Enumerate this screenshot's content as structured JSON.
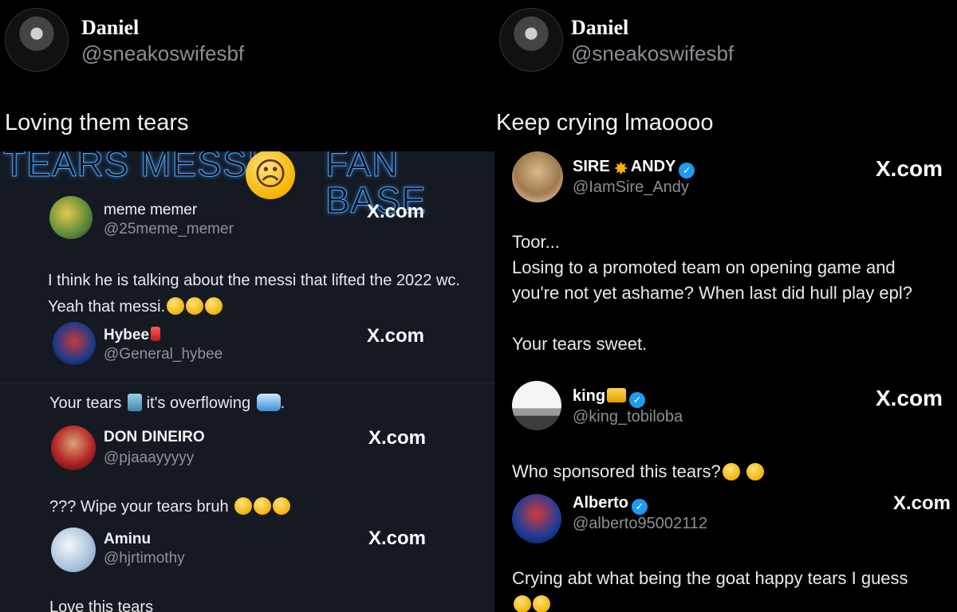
{
  "left_post": {
    "author_name": "Daniel",
    "author_handle": "@sneakoswifesbf",
    "text": "Loving them tears",
    "banner_left": "TEARS MESSI",
    "banner_right": "FAN BASE",
    "replies": [
      {
        "name": "meme memer",
        "handle": "@25meme_memer",
        "source": "X.com",
        "text": "I think he is talking about the messi that lifted the 2022 wc. Yeah that messi."
      },
      {
        "name": "Hybee",
        "handle": "@General_hybee",
        "source": "X.com",
        "text": "Your tears",
        "text_tail": "it's overflowing",
        "text_end": "."
      },
      {
        "name": "DON DINEIRO",
        "handle": "@pjaaayyyyy",
        "source": "X.com",
        "text": "??? Wipe your tears bruh"
      },
      {
        "name": "Aminu",
        "handle": "@hjrtimothy",
        "source": "X.com",
        "text": "Love this tears"
      }
    ]
  },
  "right_post": {
    "author_name": "Daniel",
    "author_handle": "@sneakoswifesbf",
    "text": "Keep crying lmaoooo",
    "replies": [
      {
        "name_a": "SIRE",
        "name_b": "ANDY",
        "handle": "@IamSire_Andy",
        "source": "X.com",
        "text": "Toor...\nLosing to a promoted team on opening game and\nyou're not yet ashame? When last did hull play epl?\n\nYour tears sweet."
      },
      {
        "name": "king",
        "handle": "@king_tobiloba",
        "source": "X.com",
        "text": "Who sponsored this tears?"
      },
      {
        "name": "Alberto",
        "handle": "@alberto95002112",
        "source": "X.com",
        "text": "Crying abt what being the goat happy tears I guess"
      }
    ]
  },
  "colors": {
    "background": "#000000",
    "collage_left": "#151a22",
    "verified": "#1d9bf0",
    "handle": "#8b8f95"
  }
}
